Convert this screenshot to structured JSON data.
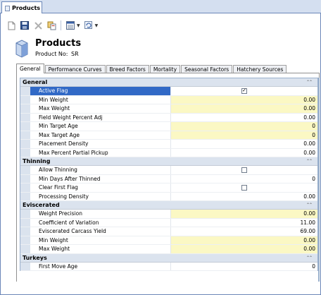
{
  "document_tab": {
    "label": "Products"
  },
  "header": {
    "title": "Products",
    "product_no_label": "Product No:",
    "product_no_value": "SR"
  },
  "tabs": [
    {
      "label": "General",
      "active": true
    },
    {
      "label": "Performance Curves",
      "active": false
    },
    {
      "label": "Breed Factors",
      "active": false
    },
    {
      "label": "Mortality",
      "active": false
    },
    {
      "label": "Seasonal Factors",
      "active": false
    },
    {
      "label": "Hatchery Sources",
      "active": false
    }
  ],
  "toolbar_icons": [
    "new-icon",
    "save-icon",
    "delete-icon",
    "copy-icon",
    "view-menu-icon",
    "refresh-menu-icon"
  ],
  "colors": {
    "selection": "#3169c6",
    "required_field": "#fbf8c4",
    "category_header": "#dbe3ee"
  },
  "sections": [
    {
      "name": "General",
      "rows": [
        {
          "label": "Active Flag",
          "type": "checkbox",
          "checked": true,
          "selected": true
        },
        {
          "label": "Min Weight",
          "value": "0.00",
          "required": true
        },
        {
          "label": "Max Weight",
          "value": "0.00",
          "required": true
        },
        {
          "label": "Field Weight Percent Adj",
          "value": "0.00"
        },
        {
          "label": "Min Target Age",
          "value": "0",
          "required": true
        },
        {
          "label": "Max Target Age",
          "value": "0",
          "required": true
        },
        {
          "label": "Placement Density",
          "value": "0.00"
        },
        {
          "label": "Max Percent Partial Pickup",
          "value": "0.00"
        }
      ]
    },
    {
      "name": "Thinning",
      "rows": [
        {
          "label": "Allow Thinning",
          "type": "checkbox",
          "checked": false
        },
        {
          "label": "Min Days After Thinned",
          "value": "0"
        },
        {
          "label": "Clear First Flag",
          "type": "checkbox",
          "checked": false
        },
        {
          "label": "Processing Density",
          "value": "0.00"
        }
      ]
    },
    {
      "name": "Eviscerated",
      "rows": [
        {
          "label": "Weight Precision",
          "value": "0.00",
          "required": true
        },
        {
          "label": "Coefficient of Variation",
          "value": "11.00"
        },
        {
          "label": "Eviscerated Carcass Yield",
          "value": "69.00"
        },
        {
          "label": "Min Weight",
          "value": "0.00",
          "required": true
        },
        {
          "label": "Max Weight",
          "value": "0.00",
          "required": true
        }
      ]
    },
    {
      "name": "Turkeys",
      "rows": [
        {
          "label": "First Move Age",
          "value": "0"
        }
      ]
    }
  ]
}
